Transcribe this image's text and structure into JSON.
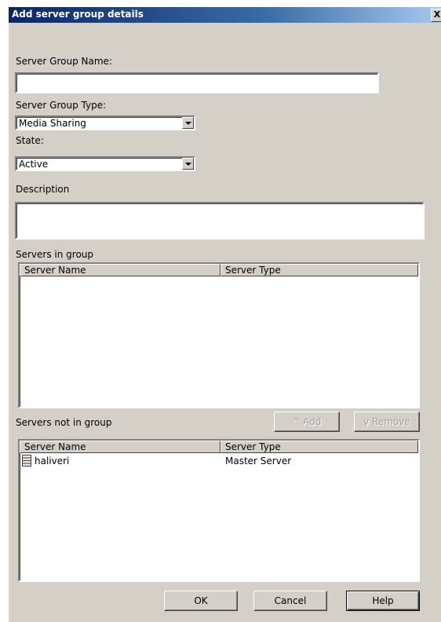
{
  "window": {
    "title": "Add server group details",
    "close_label": "X"
  },
  "form": {
    "group_name_label": "Server Group Name:",
    "group_name_value": "",
    "group_type_label": "Server Group Type:",
    "group_type_value": "Media Sharing",
    "state_label": "State:",
    "state_value": "Active",
    "description_label": "Description",
    "description_value": ""
  },
  "servers_in_group": {
    "label": "Servers in group",
    "columns": [
      "Server Name",
      "Server Type"
    ],
    "rows": []
  },
  "servers_not_in_group": {
    "label": "Servers not in group",
    "add_label": "^ Add",
    "remove_label": "v Remove",
    "columns": [
      "Server Name",
      "Server Type"
    ],
    "rows": [
      {
        "name": "haliveri",
        "type": "Master Server",
        "icon": "server-icon"
      }
    ]
  },
  "buttons": {
    "ok": "OK",
    "cancel": "Cancel",
    "help": "Help"
  }
}
